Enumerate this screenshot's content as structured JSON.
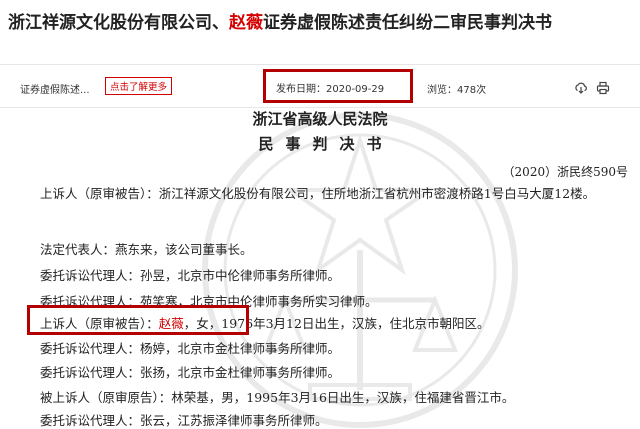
{
  "header": {
    "title_before": "浙江祥源文化股份有限公司、",
    "title_highlight": "赵薇",
    "title_after": "证券虚假陈述责任纠纷二审民事判决书"
  },
  "meta": {
    "category": "证券虚假陈述...",
    "more_label": "点击了解更多",
    "date_label": "发布日期：",
    "date_value": "2020-09-29",
    "views_label": "浏览：",
    "views_value": "478次",
    "icons": [
      "download-icon",
      "print-icon"
    ]
  },
  "document": {
    "court": "浙江省高级人民法院",
    "doc_type": "民事判决书",
    "case_no": "（2020）浙民终590号",
    "paragraphs": [
      {
        "role": "上诉人（原审被告）：",
        "text": "浙江祥源文化股份有限公司，住所地浙江省杭州市密渡桥路1号白马大厦12楼。"
      },
      {
        "role": "法定代表人：",
        "text": "燕东来，该公司董事长。"
      },
      {
        "role": "委托诉讼代理人：",
        "text": "孙昱，北京市中伦律师事务所律师。"
      },
      {
        "role": "委托诉讼代理人：",
        "text": "苑笑寒，北京市中伦律师事务所实习律师。"
      },
      {
        "role": "上诉人（原审被告）：",
        "name": "赵薇",
        "text": "，女，1976年3月12日出生，汉族，住北京市朝阳区。"
      },
      {
        "role": "委托诉讼代理人：",
        "text": "杨婷，北京市金杜律师事务所律师。"
      },
      {
        "role": "委托诉讼代理人：",
        "text": "张扬，北京市金杜律师事务所律师。"
      },
      {
        "role": "被上诉人（原审原告）：",
        "text": "林荣基，男，1995年3月16日出生，汉族，住福建省晋江市。"
      },
      {
        "role": "委托诉讼代理人：",
        "text": "张云，江苏振泽律师事务所律师。"
      }
    ]
  },
  "colors": {
    "highlight": "#d40000",
    "box": "#b30000",
    "text": "#222222"
  }
}
